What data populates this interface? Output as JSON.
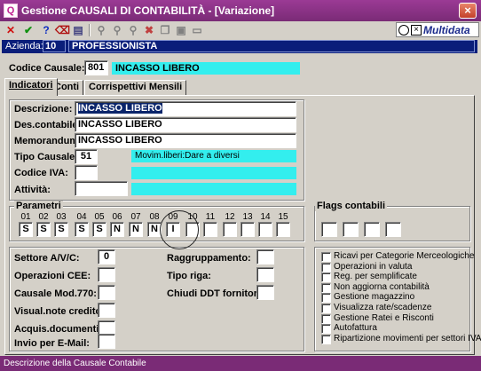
{
  "window": {
    "title": "Gestione CAUSALI DI CONTABILITÀ - [Variazione]",
    "close_glyph": "×",
    "app_icon": "Q",
    "app_icon_name": "app-logo-icon"
  },
  "toolbar": {
    "icons": [
      "cancel-icon",
      "confirm-icon",
      "help-icon",
      "delete-icon",
      "book-icon",
      "search-icon",
      "search-next-icon",
      "search-all-icon",
      "delete-record-icon",
      "copy-icon",
      "paste-icon",
      "print-icon"
    ],
    "brand": "Multidata"
  },
  "azienda": {
    "label": "Azienda:",
    "code": "10",
    "name": "PROFESSIONISTA"
  },
  "header": {
    "codice_label": "Codice Causale:",
    "codice_value": "801",
    "codice_desc": "INCASSO LIBERO"
  },
  "tabs": [
    {
      "label": "Indicatori",
      "active": true
    },
    {
      "label": "Conti",
      "active": false
    },
    {
      "label": "Corrispettivi Mensili",
      "active": false
    }
  ],
  "form": {
    "descrizione_label": "Descrizione:",
    "descrizione_value": "INCASSO LIBERO",
    "descontabile_label": "Des.contabile:",
    "descontabile_value": "INCASSO LIBERO",
    "memorandum_label": "Memorandum:",
    "memorandum_value": "INCASSO LIBERO",
    "tipo_label": "Tipo Causale:",
    "tipo_value": "51",
    "tipo_desc": "Movim.liberi:Dare a diversi",
    "iva_label": "Codice IVA:",
    "iva_value": "",
    "attivita_label": "Attività:",
    "attivita_value": ""
  },
  "parametri": {
    "title": "Parametri",
    "numbers": [
      "01",
      "02",
      "03",
      "04",
      "05",
      "06",
      "07",
      "08",
      "09",
      "10",
      "11",
      "12",
      "13",
      "14",
      "15"
    ],
    "values": [
      "S",
      "S",
      "S",
      "S",
      "S",
      "N",
      "N",
      "N",
      "I",
      "",
      "",
      "",
      "",
      "",
      ""
    ]
  },
  "flags": {
    "title": "Flags contabili",
    "values": [
      "",
      "",
      "",
      ""
    ]
  },
  "left_fields": [
    {
      "label": "Settore A/V/C:",
      "value": "0"
    },
    {
      "label": "Operazioni CEE:",
      "value": ""
    },
    {
      "label": "Causale Mod.770:",
      "value": ""
    },
    {
      "label": "Visual.note credito:",
      "value": ""
    },
    {
      "label": "Acquis.documenti:",
      "value": ""
    },
    {
      "label": "Invio per E-Mail:",
      "value": ""
    }
  ],
  "mid_fields": [
    {
      "label": "Raggruppamento:",
      "value": ""
    },
    {
      "label": "Tipo riga:",
      "value": ""
    },
    {
      "label": "Chiudi DDT fornitori:",
      "value": ""
    }
  ],
  "checkboxes": [
    {
      "label": "Ricavi per Categorie Merceologiche",
      "checked": false
    },
    {
      "label": "Operazioni in valuta",
      "checked": false
    },
    {
      "label": "Reg. per semplificate",
      "checked": false
    },
    {
      "label": "Non aggiorna contabilità",
      "checked": false
    },
    {
      "label": "Gestione magazzino",
      "checked": false
    },
    {
      "label": "Visualizza rate/scadenze",
      "checked": false
    },
    {
      "label": "Gestione Ratei e Risconti",
      "checked": false
    },
    {
      "label": "Autofattura",
      "checked": false
    },
    {
      "label": "Ripartizione movimenti per settori IVA",
      "checked": false
    }
  ],
  "status": {
    "text": "Descrizione della Causale Contabile"
  }
}
